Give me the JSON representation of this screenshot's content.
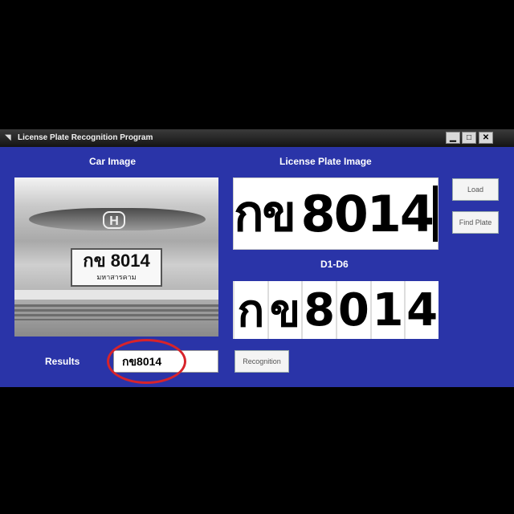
{
  "window": {
    "title": "License Plate Recognition Program",
    "controls": {
      "minimize": "▁",
      "maximize": "□",
      "close": "✕"
    }
  },
  "labels": {
    "car_image": "Car Image",
    "license_plate_image": "License Plate Image",
    "segments": "D1-D6",
    "results": "Results"
  },
  "buttons": {
    "load": "Load",
    "find_plate": "Find Plate",
    "recognition": "Recognition"
  },
  "car_image": {
    "plate_text": "กข 8014",
    "plate_province": "มหาสารคาม",
    "brand": "H"
  },
  "plate_image": {
    "chars": [
      "ก",
      "ข",
      " ",
      "8",
      "0",
      "1",
      "4"
    ]
  },
  "segments": {
    "chars": [
      "ก",
      "ข",
      "8",
      "0",
      "1",
      "4"
    ]
  },
  "results": {
    "value": "กข8014"
  },
  "colors": {
    "window_bg": "#2a34a8",
    "highlight": "#d8232a"
  }
}
